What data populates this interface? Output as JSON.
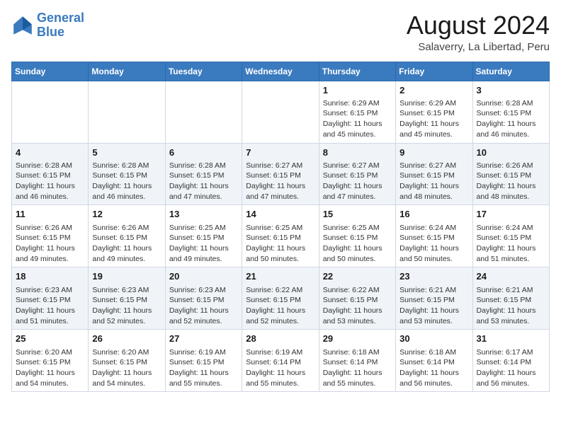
{
  "logo": {
    "line1": "General",
    "line2": "Blue"
  },
  "title": "August 2024",
  "subtitle": "Salaverry, La Libertad, Peru",
  "headers": [
    "Sunday",
    "Monday",
    "Tuesday",
    "Wednesday",
    "Thursday",
    "Friday",
    "Saturday"
  ],
  "weeks": [
    [
      {
        "day": "",
        "info": ""
      },
      {
        "day": "",
        "info": ""
      },
      {
        "day": "",
        "info": ""
      },
      {
        "day": "",
        "info": ""
      },
      {
        "day": "1",
        "info": "Sunrise: 6:29 AM\nSunset: 6:15 PM\nDaylight: 11 hours\nand 45 minutes."
      },
      {
        "day": "2",
        "info": "Sunrise: 6:29 AM\nSunset: 6:15 PM\nDaylight: 11 hours\nand 45 minutes."
      },
      {
        "day": "3",
        "info": "Sunrise: 6:28 AM\nSunset: 6:15 PM\nDaylight: 11 hours\nand 46 minutes."
      }
    ],
    [
      {
        "day": "4",
        "info": "Sunrise: 6:28 AM\nSunset: 6:15 PM\nDaylight: 11 hours\nand 46 minutes."
      },
      {
        "day": "5",
        "info": "Sunrise: 6:28 AM\nSunset: 6:15 PM\nDaylight: 11 hours\nand 46 minutes."
      },
      {
        "day": "6",
        "info": "Sunrise: 6:28 AM\nSunset: 6:15 PM\nDaylight: 11 hours\nand 47 minutes."
      },
      {
        "day": "7",
        "info": "Sunrise: 6:27 AM\nSunset: 6:15 PM\nDaylight: 11 hours\nand 47 minutes."
      },
      {
        "day": "8",
        "info": "Sunrise: 6:27 AM\nSunset: 6:15 PM\nDaylight: 11 hours\nand 47 minutes."
      },
      {
        "day": "9",
        "info": "Sunrise: 6:27 AM\nSunset: 6:15 PM\nDaylight: 11 hours\nand 48 minutes."
      },
      {
        "day": "10",
        "info": "Sunrise: 6:26 AM\nSunset: 6:15 PM\nDaylight: 11 hours\nand 48 minutes."
      }
    ],
    [
      {
        "day": "11",
        "info": "Sunrise: 6:26 AM\nSunset: 6:15 PM\nDaylight: 11 hours\nand 49 minutes."
      },
      {
        "day": "12",
        "info": "Sunrise: 6:26 AM\nSunset: 6:15 PM\nDaylight: 11 hours\nand 49 minutes."
      },
      {
        "day": "13",
        "info": "Sunrise: 6:25 AM\nSunset: 6:15 PM\nDaylight: 11 hours\nand 49 minutes."
      },
      {
        "day": "14",
        "info": "Sunrise: 6:25 AM\nSunset: 6:15 PM\nDaylight: 11 hours\nand 50 minutes."
      },
      {
        "day": "15",
        "info": "Sunrise: 6:25 AM\nSunset: 6:15 PM\nDaylight: 11 hours\nand 50 minutes."
      },
      {
        "day": "16",
        "info": "Sunrise: 6:24 AM\nSunset: 6:15 PM\nDaylight: 11 hours\nand 50 minutes."
      },
      {
        "day": "17",
        "info": "Sunrise: 6:24 AM\nSunset: 6:15 PM\nDaylight: 11 hours\nand 51 minutes."
      }
    ],
    [
      {
        "day": "18",
        "info": "Sunrise: 6:23 AM\nSunset: 6:15 PM\nDaylight: 11 hours\nand 51 minutes."
      },
      {
        "day": "19",
        "info": "Sunrise: 6:23 AM\nSunset: 6:15 PM\nDaylight: 11 hours\nand 52 minutes."
      },
      {
        "day": "20",
        "info": "Sunrise: 6:23 AM\nSunset: 6:15 PM\nDaylight: 11 hours\nand 52 minutes."
      },
      {
        "day": "21",
        "info": "Sunrise: 6:22 AM\nSunset: 6:15 PM\nDaylight: 11 hours\nand 52 minutes."
      },
      {
        "day": "22",
        "info": "Sunrise: 6:22 AM\nSunset: 6:15 PM\nDaylight: 11 hours\nand 53 minutes."
      },
      {
        "day": "23",
        "info": "Sunrise: 6:21 AM\nSunset: 6:15 PM\nDaylight: 11 hours\nand 53 minutes."
      },
      {
        "day": "24",
        "info": "Sunrise: 6:21 AM\nSunset: 6:15 PM\nDaylight: 11 hours\nand 53 minutes."
      }
    ],
    [
      {
        "day": "25",
        "info": "Sunrise: 6:20 AM\nSunset: 6:15 PM\nDaylight: 11 hours\nand 54 minutes."
      },
      {
        "day": "26",
        "info": "Sunrise: 6:20 AM\nSunset: 6:15 PM\nDaylight: 11 hours\nand 54 minutes."
      },
      {
        "day": "27",
        "info": "Sunrise: 6:19 AM\nSunset: 6:15 PM\nDaylight: 11 hours\nand 55 minutes."
      },
      {
        "day": "28",
        "info": "Sunrise: 6:19 AM\nSunset: 6:14 PM\nDaylight: 11 hours\nand 55 minutes."
      },
      {
        "day": "29",
        "info": "Sunrise: 6:18 AM\nSunset: 6:14 PM\nDaylight: 11 hours\nand 55 minutes."
      },
      {
        "day": "30",
        "info": "Sunrise: 6:18 AM\nSunset: 6:14 PM\nDaylight: 11 hours\nand 56 minutes."
      },
      {
        "day": "31",
        "info": "Sunrise: 6:17 AM\nSunset: 6:14 PM\nDaylight: 11 hours\nand 56 minutes."
      }
    ]
  ]
}
